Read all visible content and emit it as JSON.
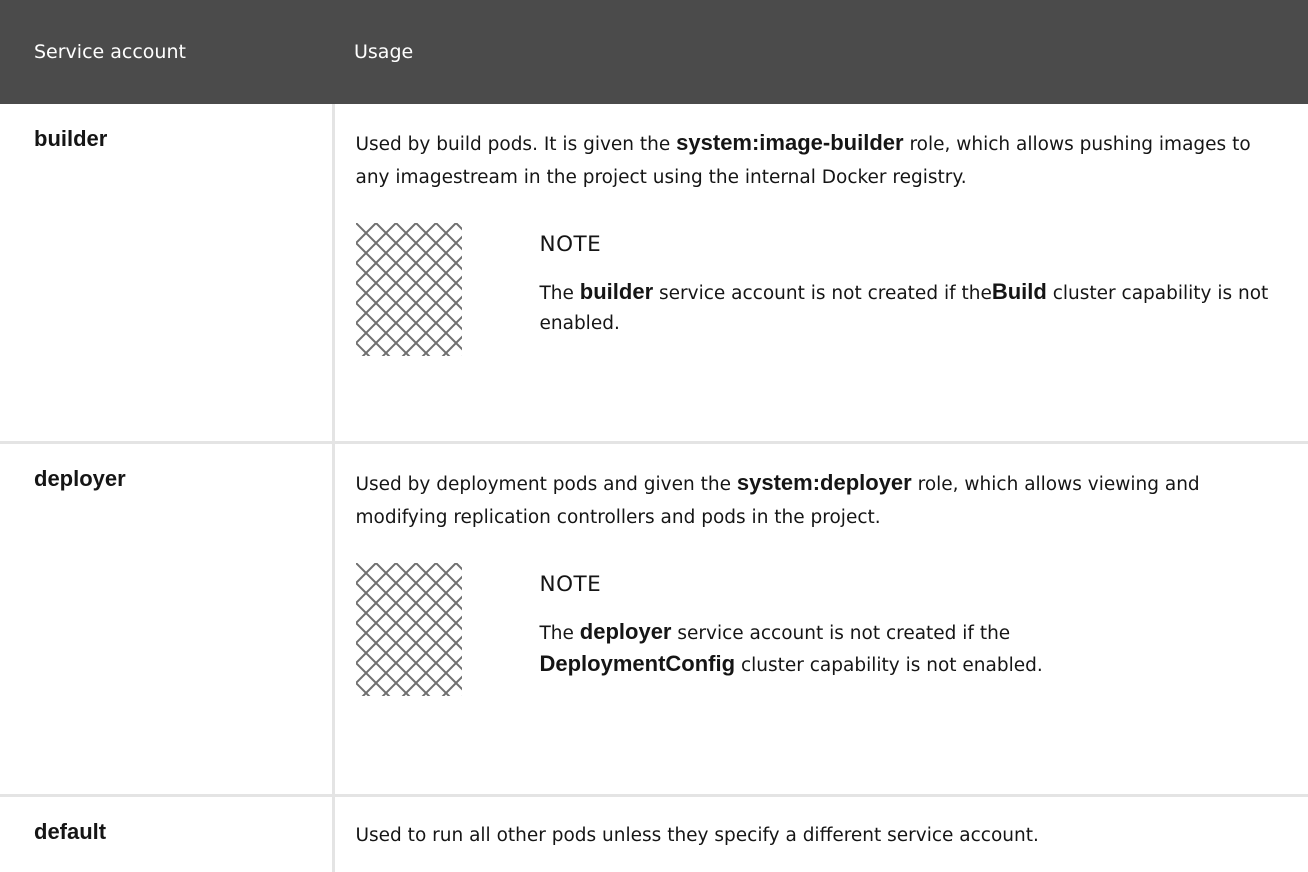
{
  "table": {
    "headers": [
      "Service account",
      "Usage"
    ],
    "rows": [
      {
        "account": "builder",
        "desc": {
          "pre": "Used by build pods. It is given the ",
          "bold": "system:image-builder",
          "post": " role, which allows pushing images to any imagestream in the project using the internal Docker registry."
        },
        "note": {
          "title": "NOTE",
          "t1": "The ",
          "b1": "builder",
          "t2": " service account is not created if the",
          "b2": "Build",
          "t3": " cluster capability is not enabled."
        }
      },
      {
        "account": "deployer",
        "desc": {
          "pre": "Used by deployment pods and given the ",
          "bold": "system:deployer",
          "post": " role, which allows viewing and modifying replication controllers and pods in the project."
        },
        "note": {
          "title": "NOTE",
          "t1": "The ",
          "b1": "deployer",
          "t2": " service account is not created if the ",
          "b2": "DeploymentConfig",
          "t3": " cluster capability is not enabled."
        }
      },
      {
        "account": "default",
        "desc": {
          "pre": "Used to run all other pods unless they specify a different service account."
        }
      }
    ]
  },
  "icons": {
    "note": "note-lattice-icon"
  },
  "colors": {
    "header_bg": "#4b4b4b",
    "header_text": "#ffffff",
    "border": "#e4e4e4",
    "text": "#151515"
  }
}
